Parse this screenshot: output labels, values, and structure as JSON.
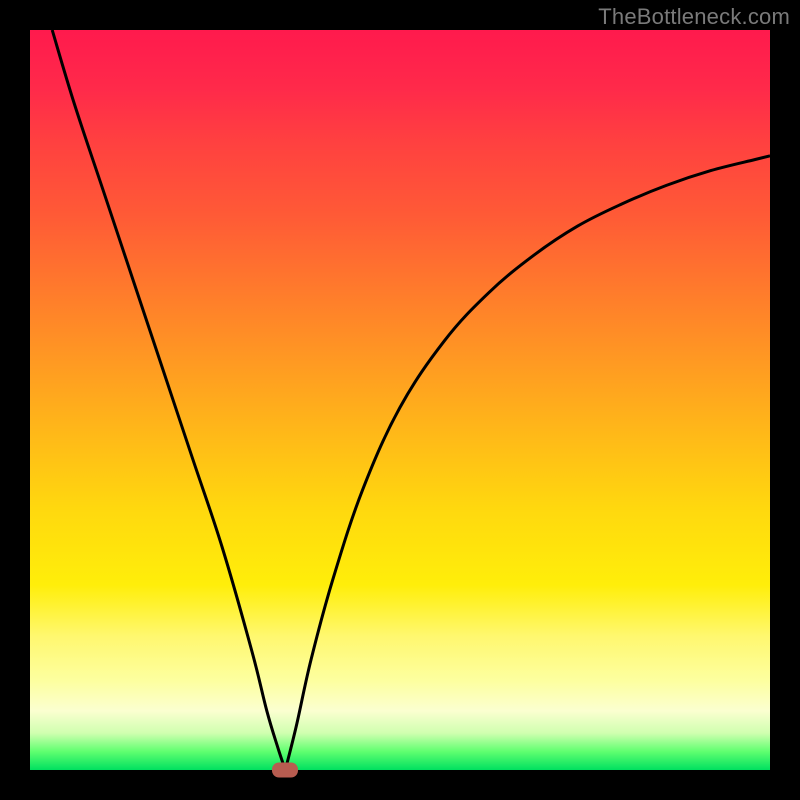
{
  "attribution": "TheBottleneck.com",
  "chart_data": {
    "type": "line",
    "title": "",
    "xlabel": "",
    "ylabel": "",
    "xlim": [
      0,
      100
    ],
    "ylim": [
      0,
      100
    ],
    "series": [
      {
        "name": "left-branch",
        "x": [
          3,
          6,
          10,
          14,
          18,
          22,
          26,
          30,
          32,
          33.5,
          34.5
        ],
        "y": [
          100,
          90,
          78,
          66,
          54,
          42,
          30,
          16,
          8,
          3,
          0
        ]
      },
      {
        "name": "right-branch",
        "x": [
          34.5,
          36,
          38,
          41,
          45,
          50,
          56,
          62,
          68,
          74,
          80,
          86,
          92,
          98,
          100
        ],
        "y": [
          0,
          6,
          15,
          26,
          38,
          49,
          58,
          64.5,
          69.5,
          73.5,
          76.5,
          79,
          81,
          82.5,
          83
        ]
      }
    ],
    "marker": {
      "x": 34.5,
      "y": 0
    },
    "background_gradient": {
      "top": "#ff1a4d",
      "bottom": "#00e060"
    }
  }
}
